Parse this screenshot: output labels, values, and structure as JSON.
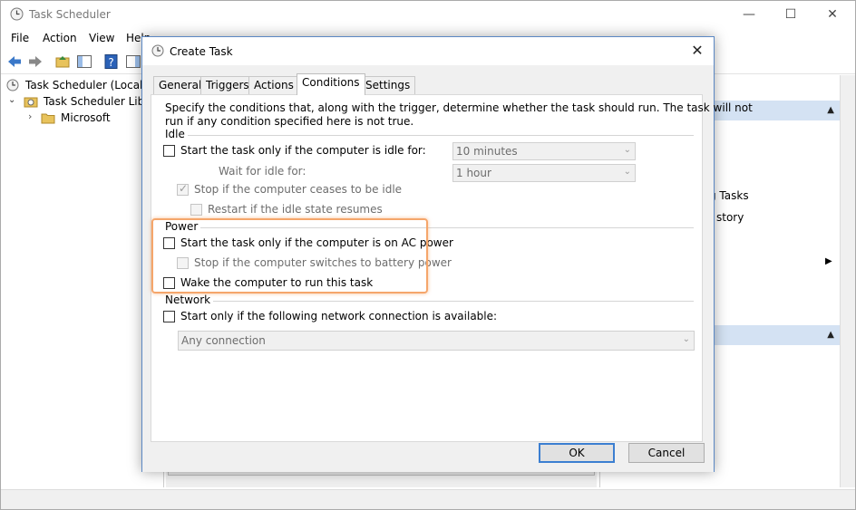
{
  "main_window": {
    "title": "Task Scheduler",
    "menu": [
      "File",
      "Action",
      "View",
      "Help"
    ],
    "controls": {
      "minimize": "—",
      "maximize": "☐",
      "close": "✕"
    }
  },
  "tree": {
    "root": "Task Scheduler (Local)",
    "library": "Task Scheduler Library",
    "child": "Microsoft"
  },
  "actions_pane": {
    "item1": "g Tasks",
    "item2": "story"
  },
  "dialog": {
    "title": "Create Task",
    "close_symbol": "✕",
    "tabs": [
      "General",
      "Triggers",
      "Actions",
      "Conditions",
      "Settings"
    ],
    "active_tab": "Conditions",
    "description_line1": "Specify the conditions that, along with the trigger, determine whether the task should run.  The task will not",
    "description_line2": "run  if any condition specified here is not true.",
    "idle": {
      "group_label": "Idle",
      "start_idle_label": "Start the task only if the computer is idle for:",
      "start_idle_checked": false,
      "idle_duration": "10 minutes",
      "wait_label": "Wait for idle for:",
      "wait_duration": "1 hour",
      "stop_idle_label": "Stop if the computer ceases to be idle",
      "stop_idle_checked": true,
      "restart_label": "Restart if the idle state resumes",
      "restart_checked": false
    },
    "power": {
      "group_label": "Power",
      "ac_label": "Start the task only if the computer is on AC power",
      "ac_checked": false,
      "battery_label": "Stop if the computer switches to battery power",
      "battery_checked": false,
      "wake_label": "Wake the computer to run this task",
      "wake_checked": false
    },
    "network": {
      "group_label": "Network",
      "network_label": "Start only if the following network connection is available:",
      "network_checked": false,
      "connection": "Any connection"
    },
    "ok_label": "OK",
    "cancel_label": "Cancel"
  },
  "colors": {
    "highlight": "#f5a66b",
    "dialog_border": "#5b88c4",
    "action_header": "#d4e2f3",
    "default_button_border": "#3c7fd1"
  }
}
